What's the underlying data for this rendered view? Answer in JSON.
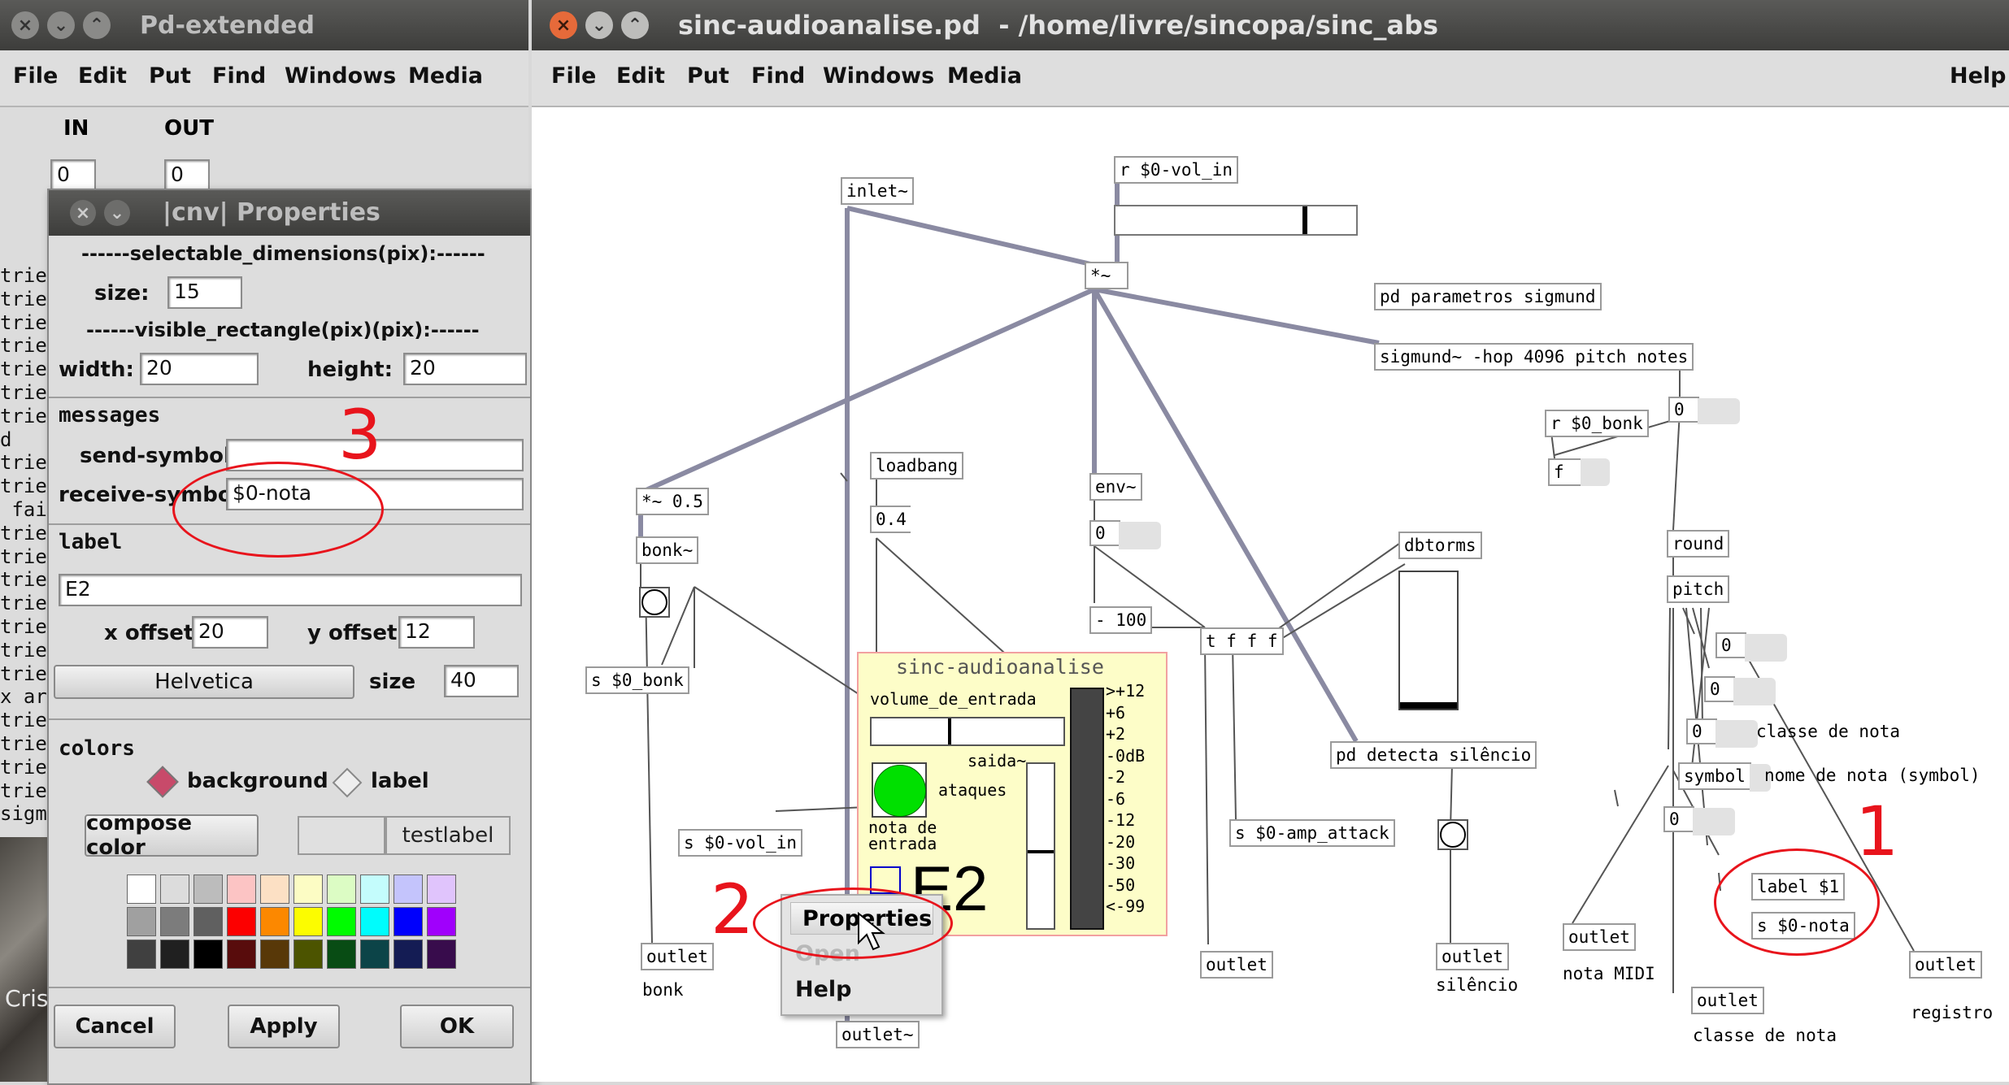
{
  "pd_main": {
    "title": "Pd-extended",
    "menu": [
      "File",
      "Edit",
      "Put",
      "Find",
      "Windows",
      "Media"
    ],
    "in_label": "IN",
    "out_label": "OUT",
    "in_value": "0",
    "out_value": "0",
    "console_lines": [
      "trie",
      "trie",
      "trie",
      "trie",
      "trie",
      "trie",
      "trie",
      "d",
      "trie",
      "trie",
      " fai",
      "trie",
      "trie",
      "trie",
      "trie",
      "trie",
      "trie",
      "trie",
      "x ar",
      "trie",
      "trie",
      "trie",
      "trie",
      "sigm"
    ],
    "bottom_text": "Cris"
  },
  "cnv_props": {
    "title": "|cnv| Properties",
    "sel_dims_header": "------selectable_dimensions(pix):------",
    "size_label": "size:",
    "size_value": "15",
    "vis_rect_header": "------visible_rectangle(pix)(pix):------",
    "width_label": "width:",
    "width_value": "20",
    "height_label": "height:",
    "height_value": "20",
    "messages_header": "messages",
    "send_label": "send-symbol:",
    "send_value": "",
    "receive_label": "receive-symbol",
    "receive_value": "$0-nota",
    "label_header": "label",
    "label_value": "E2",
    "xoff_label": "x offset",
    "xoff_value": "20",
    "yoff_label": "y offset",
    "yoff_value": "12",
    "font_value": "Helvetica",
    "font_size_label": "size",
    "font_size_value": "40",
    "colors_header": "colors",
    "radio_background": "background",
    "radio_label": "label",
    "compose_button": "compose color",
    "testlabel": "testlabel",
    "cancel": "Cancel",
    "apply": "Apply",
    "ok": "OK",
    "palette": [
      "#ffffff",
      "#dcdcdc",
      "#bcbcbc",
      "#fcc4c4",
      "#fce0c4",
      "#fcfcc4",
      "#dcfcc4",
      "#c4fcfc",
      "#c4c4fc",
      "#e0c4fc",
      "#a0a0a0",
      "#7c7c7c",
      "#606060",
      "#fc0000",
      "#fc8800",
      "#fcfc00",
      "#00fc00",
      "#00fcfc",
      "#0000fc",
      "#a000fc",
      "#404040",
      "#202020",
      "#000000",
      "#580c0c",
      "#583808",
      "#4c5400",
      "#084c14",
      "#0c4448",
      "#141c54",
      "#380c4c"
    ]
  },
  "patch": {
    "title": "sinc-audioanalise.pd  - /home/livre/sincopa/sinc_abs",
    "menu": [
      "File",
      "Edit",
      "Put",
      "Find",
      "Windows",
      "Media"
    ],
    "help": "Help",
    "objects": {
      "inlet": "inlet~",
      "r_vol": "r $0-vol_in",
      "mult": "*~",
      "pd_param": "pd parametros sigmund",
      "sigmund": "sigmund~ -hop 4096 pitch notes",
      "r_bonk": "r $0_bonk",
      "f": "f",
      "mult05": "*~ 0.5",
      "loadbang": "loadbang",
      "env": "env~",
      "bonk": "bonk~",
      "minus100": "- 100",
      "dbtorms": "dbtorms",
      "tfff": "t f f f",
      "s_bonk": "s $0_bonk",
      "s_vol": "s $0-vol_in",
      "s_amp": "s $0-amp_attack",
      "pd_detecta": "pd detecta silêncio",
      "round": "round",
      "pitch": "pitch",
      "symbol": "symbol",
      "label1": "label $1",
      "s_nota": "s $0-nota",
      "outlet_bonk": "outlet",
      "outlet_sig": "outlet~",
      "outlet_tfff": "outlet",
      "outlet_sil": "outlet",
      "outlet_midi": "outlet",
      "outlet_classe": "outlet",
      "outlet_reg": "outlet"
    },
    "msgs": {
      "m04": "0.4"
    },
    "numbers": {
      "sig_num": "0",
      "env_num": "0",
      "p1": "0",
      "p2": "0",
      "p3": "0",
      "p4": "0"
    },
    "comments": {
      "bonk": "bonk",
      "silencio": "silêncio",
      "nota_midi": "nota MIDI",
      "classe_nota": "classe de nota",
      "classe_nota2": "classe de nota",
      "nome_nota": "nome de nota (symbol)",
      "registro": "registro"
    },
    "gop": {
      "title": "sinc-audioanalise",
      "volume": "volume_de_entrada",
      "saida": "saida~",
      "ataques": "ataques",
      "nota_de": "nota de",
      "entrada": "entrada",
      "big_label": "E2",
      "vu_scale": [
        ">+12",
        "+6",
        "+2",
        "-0dB",
        "-2",
        "-6",
        "-12",
        "-20",
        "-30",
        "-50",
        "<-99"
      ]
    },
    "annotations": [
      "1",
      "2",
      "3"
    ],
    "context_menu": [
      "Properties",
      "Open",
      "Help"
    ]
  }
}
